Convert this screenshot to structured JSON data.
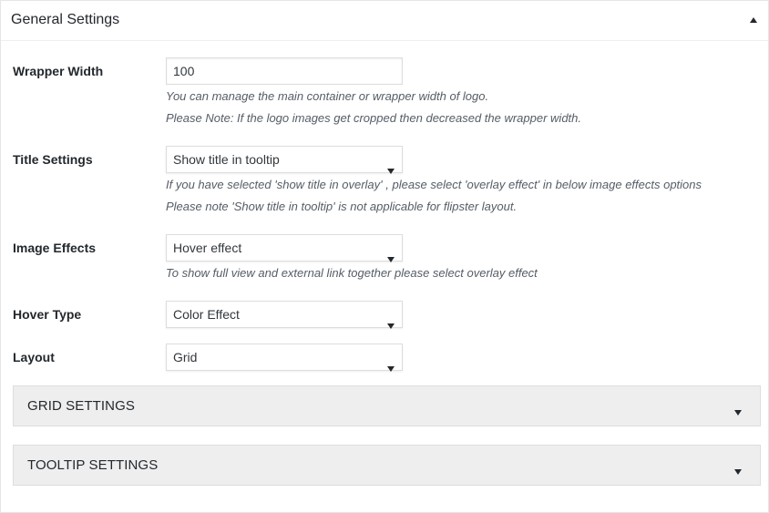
{
  "panel": {
    "title": "General Settings",
    "collapse_icon": "triangle-up-icon"
  },
  "fields": {
    "wrapper_width": {
      "label": "Wrapper Width",
      "value": "100",
      "desc_1": "You can manage the main container or wrapper width of logo.",
      "desc_2": "Please Note: If the logo images get cropped then decreased the wrapper width."
    },
    "title_settings": {
      "label": "Title Settings",
      "selected": "Show title in tooltip",
      "desc_1": "If you have selected 'show title in overlay' , please select 'overlay effect' in below image effects options",
      "desc_2": "Please note 'Show title in tooltip' is not applicable for flipster layout."
    },
    "image_effects": {
      "label": "Image Effects",
      "selected": "Hover effect",
      "desc_1": "To show full view and external link together please select overlay effect"
    },
    "hover_type": {
      "label": "Hover Type",
      "selected": "Color Effect"
    },
    "layout": {
      "label": "Layout",
      "selected": "Grid"
    }
  },
  "accordions": {
    "grid": {
      "title": "GRID SETTINGS",
      "icon": "triangle-down-icon"
    },
    "tooltip": {
      "title": "TOOLTIP SETTINGS",
      "icon": "triangle-down-icon"
    }
  },
  "colors": {
    "text": "#23282d",
    "muted": "#555d66",
    "border": "#dddddd",
    "accordion_bg": "#eeeeee"
  }
}
